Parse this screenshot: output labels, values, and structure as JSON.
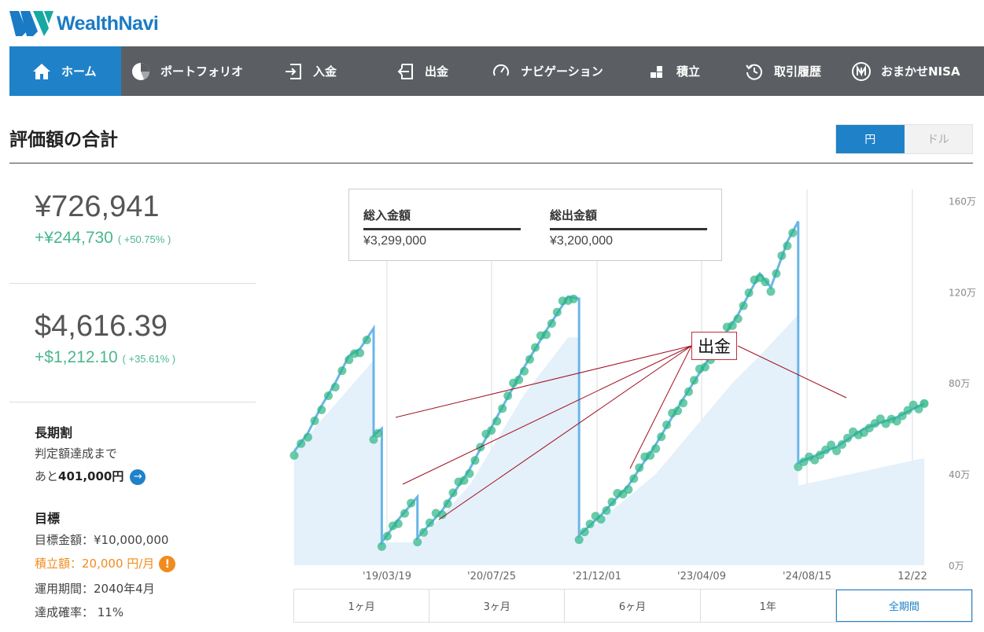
{
  "brand": {
    "name": "WealthNavi"
  },
  "nav": [
    {
      "label": "ホーム",
      "icon": "home-icon",
      "active": true
    },
    {
      "label": "ポートフォリオ",
      "icon": "pie-chart-icon"
    },
    {
      "label": "入金",
      "icon": "deposit-icon"
    },
    {
      "label": "出金",
      "icon": "withdraw-icon"
    },
    {
      "label": "ナビゲーション",
      "icon": "gauge-icon"
    },
    {
      "label": "積立",
      "icon": "blocks-icon"
    },
    {
      "label": "取引履歴",
      "icon": "history-icon"
    },
    {
      "label": "おまかせNISA",
      "icon": "nisa-logo-icon"
    }
  ],
  "page": {
    "title": "評価額の合計"
  },
  "currency": {
    "yen": "円",
    "dollar": "ドル",
    "selected": "円"
  },
  "summary": {
    "jpy_value": "¥726,941",
    "jpy_gain": "+¥244,730",
    "jpy_gain_pct": "( +50.75% )",
    "usd_value": "$4,616.39",
    "usd_gain": "+$1,212.10",
    "usd_gain_pct": "( +35.61% )"
  },
  "long_term": {
    "heading": "長期割",
    "line1": "判定額達成まで",
    "line2_prefix": "あと",
    "line2_amount": "401,000円"
  },
  "goal": {
    "heading": "目標",
    "target_amount": "目標金額：¥10,000,000",
    "monthly": "積立額：20,000 円/月",
    "period": "運用期間：2040年4月",
    "probability": "達成確率： 11%"
  },
  "tooltip": {
    "deposit_label": "総入金額",
    "deposit_value": "¥3,299,000",
    "withdraw_label": "総出金額",
    "withdraw_value": "¥3,200,000"
  },
  "annotation": {
    "label": "出金"
  },
  "periods": [
    {
      "label": "1ヶ月"
    },
    {
      "label": "3ヶ月"
    },
    {
      "label": "6ヶ月"
    },
    {
      "label": "1年"
    },
    {
      "label": "全期間",
      "active": true
    }
  ],
  "colors": {
    "accent": "#1f82c9",
    "gain": "#4bb78e",
    "warning": "#f08c1e",
    "nav_bg": "#5b5f63",
    "dots": "#2bb583"
  },
  "chart_data": {
    "type": "line",
    "x_ticks": [
      "'19/03/19",
      "'20/07/25",
      "'21/12/01",
      "'23/04/09",
      "'24/08/15",
      "12/22"
    ],
    "y_ticks": [
      "0万",
      "40万",
      "80万",
      "120万",
      "160万"
    ],
    "ylim": [
      0,
      165
    ],
    "series": [
      {
        "kind": "valuation",
        "values": [
          [
            0,
            50
          ],
          [
            0.25,
            58
          ],
          [
            0.5,
            70
          ],
          [
            0.75,
            80
          ],
          [
            1.0,
            92
          ],
          [
            1.2,
            95
          ],
          [
            1.45,
            104
          ],
          [
            1.45,
            57
          ],
          [
            1.6,
            60
          ],
          [
            1.6,
            10
          ],
          [
            1.9,
            20
          ],
          [
            2.25,
            30
          ],
          [
            2.25,
            12
          ],
          [
            2.7,
            24
          ],
          [
            3.2,
            42
          ],
          [
            3.7,
            65
          ],
          [
            4.2,
            87
          ],
          [
            4.6,
            103
          ],
          [
            5.0,
            118
          ],
          [
            5.2,
            117
          ],
          [
            5.2,
            13
          ],
          [
            5.6,
            22
          ],
          [
            6.1,
            35
          ],
          [
            6.6,
            53
          ],
          [
            7.1,
            73
          ],
          [
            7.6,
            92
          ],
          [
            8.1,
            110
          ],
          [
            8.5,
            128
          ],
          [
            8.7,
            122
          ],
          [
            9.0,
            142
          ],
          [
            9.2,
            151
          ],
          [
            9.2,
            45
          ],
          [
            9.5,
            48
          ],
          [
            9.9,
            52
          ],
          [
            10.4,
            60
          ],
          [
            11.0,
            65
          ],
          [
            11.5,
            71
          ]
        ]
      },
      {
        "kind": "deposits",
        "values": [
          [
            0,
            50
          ],
          [
            1.45,
            90
          ],
          [
            1.45,
            55
          ],
          [
            1.6,
            55
          ],
          [
            1.6,
            10
          ],
          [
            2.25,
            10
          ],
          [
            3.2,
            35
          ],
          [
            4.2,
            75
          ],
          [
            5.0,
            100
          ],
          [
            5.2,
            100
          ],
          [
            5.2,
            12
          ],
          [
            6.6,
            40
          ],
          [
            8.0,
            80
          ],
          [
            8.5,
            92
          ],
          [
            9.2,
            110
          ],
          [
            9.2,
            35
          ],
          [
            11.5,
            47
          ]
        ]
      }
    ],
    "withdrawals": [
      "出金",
      "出金",
      "出金",
      "出金",
      "出金"
    ]
  }
}
